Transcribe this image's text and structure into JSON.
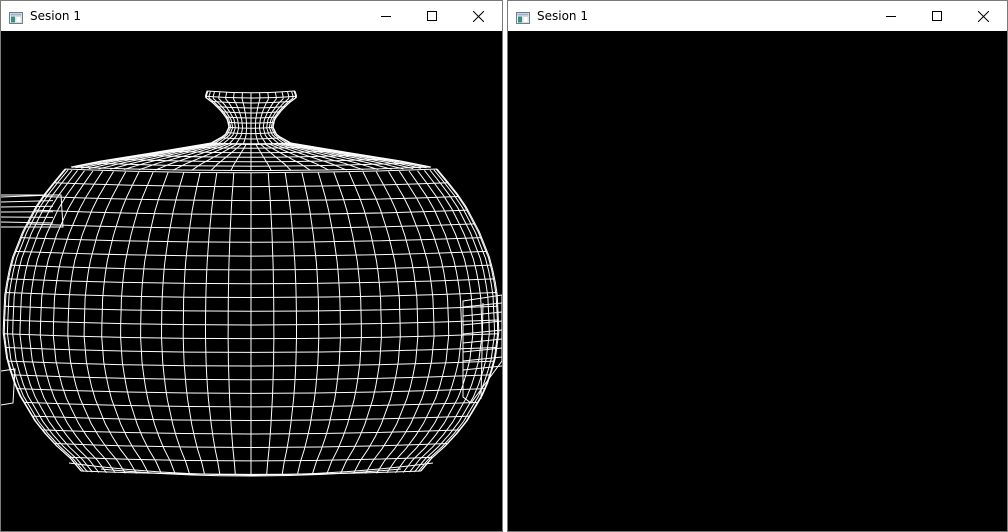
{
  "windows": [
    {
      "title": "Sesion 1",
      "icon": "app-window-icon",
      "controls": [
        "minimize-icon",
        "maximize-icon",
        "close-icon"
      ],
      "content": "teapot-wireframe"
    },
    {
      "title": "Sesion 1",
      "icon": "app-window-icon",
      "controls": [
        "minimize-icon",
        "maximize-icon",
        "close-icon"
      ],
      "content": "blank"
    }
  ],
  "colors": {
    "viewport_background": "#000000",
    "wireframe": "#ffffff",
    "titlebar": "#ffffff"
  }
}
